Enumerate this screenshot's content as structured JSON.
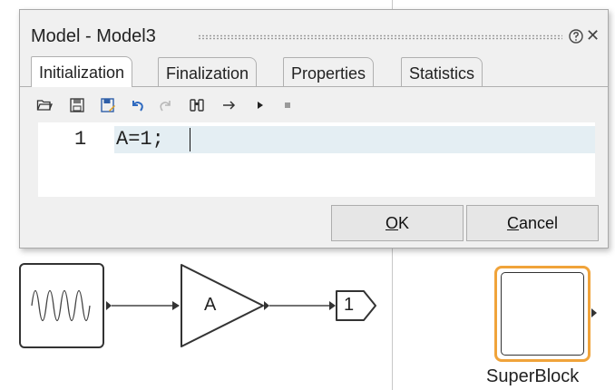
{
  "dialog": {
    "title": "Model - Model3",
    "tabs": [
      {
        "label": "Initialization"
      },
      {
        "label": "Finalization"
      },
      {
        "label": "Properties"
      },
      {
        "label": "Statistics"
      }
    ],
    "active_tab": "Initialization",
    "toolbar": [
      "open-icon",
      "save-icon",
      "save-as-icon",
      "undo-icon",
      "redo-icon",
      "find-icon",
      "goto-icon",
      "run-icon",
      "stop-icon"
    ],
    "editor": {
      "line_number": "1",
      "code": "A=1;"
    },
    "buttons": {
      "ok_mnemonic": "O",
      "ok_rest": "K",
      "cancel_mnemonic": "C",
      "cancel_rest": "ancel"
    }
  },
  "diagram": {
    "gain_label": "A",
    "outport_label": "1",
    "superblock_label": "SuperBlock",
    "accent_color": "#f0a33a"
  }
}
